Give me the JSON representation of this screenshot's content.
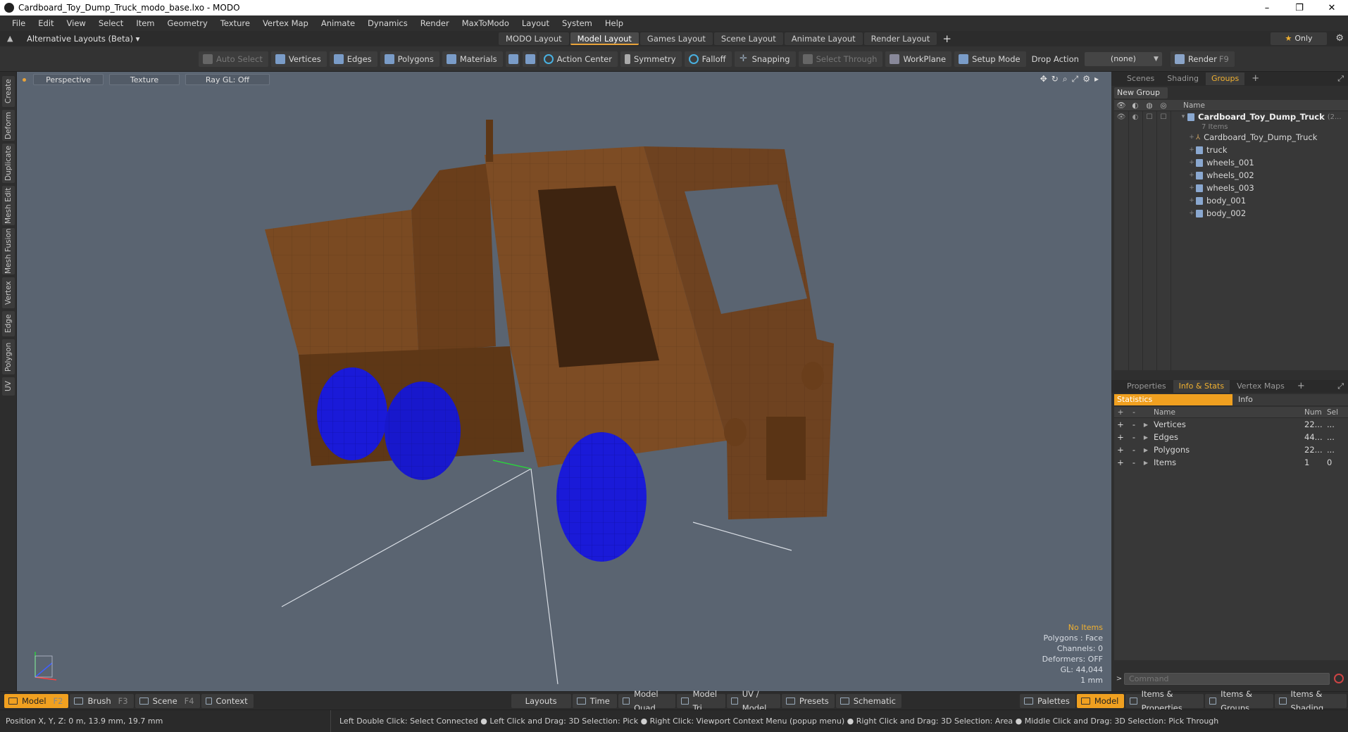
{
  "window": {
    "title": "Cardboard_Toy_Dump_Truck_modo_base.lxo - MODO",
    "minimize": "–",
    "maximize": "❐",
    "close": "✕"
  },
  "menu": [
    "File",
    "Edit",
    "View",
    "Select",
    "Item",
    "Geometry",
    "Texture",
    "Vertex Map",
    "Animate",
    "Dynamics",
    "Render",
    "MaxToModo",
    "Layout",
    "System",
    "Help"
  ],
  "layouts": {
    "alt_label": "Alternative Layouts (Beta) ▾",
    "tabs": [
      "MODO Layout",
      "Model Layout",
      "Games Layout",
      "Scene Layout",
      "Animate Layout",
      "Render Layout"
    ],
    "active_tab": "Model Layout",
    "plus": "+",
    "only": "Only",
    "star": "★",
    "gear": "⚙"
  },
  "toolbar": {
    "auto_select": "Auto Select",
    "vertices": "Vertices",
    "edges": "Edges",
    "polygons": "Polygons",
    "materials": "Materials",
    "action_center": "Action Center",
    "symmetry": "Symmetry",
    "falloff": "Falloff",
    "snapping": "Snapping",
    "select_through": "Select Through",
    "workplane": "WorkPlane",
    "setup_mode": "Setup Mode",
    "drop_action_label": "Drop Action",
    "drop_action_value": "(none)",
    "render": "Render",
    "render_key": "F9"
  },
  "left_tabs": [
    "Create",
    "Deform",
    "Duplicate",
    "Mesh Edit",
    "Mesh Fusion",
    "Vertex",
    "Edge",
    "Polygon",
    "UV"
  ],
  "viewport": {
    "view": "Perspective",
    "shading": "Texture",
    "raygl": "Ray GL: Off",
    "info": {
      "items": "No Items",
      "polygons": "Polygons : Face",
      "channels": "Channels: 0",
      "deformers": "Deformers: OFF",
      "gl": "GL: 44,044",
      "unit": "1 mm"
    },
    "colors": {
      "background": "#5a6471",
      "cardboard": "#7a4a22",
      "wheels": "#1a1ad8"
    }
  },
  "scene_panel": {
    "tabs": [
      "Scenes",
      "Shading",
      "Groups"
    ],
    "active_tab": "Groups",
    "new_group": "New Group",
    "name_header": "Name",
    "group": {
      "name": "Cardboard_Toy_Dump_Truck",
      "suffix": "(2...",
      "count": "7 Items"
    },
    "items": [
      "Cardboard_Toy_Dump_Truck",
      "truck",
      "wheels_001",
      "wheels_002",
      "wheels_003",
      "body_001",
      "body_002"
    ]
  },
  "info_panel": {
    "tabs": [
      "Properties",
      "Info & Stats",
      "Vertex Maps"
    ],
    "active_tab": "Info & Stats",
    "sub_tabs": {
      "statistics": "Statistics",
      "info": "Info"
    },
    "headers": {
      "name": "Name",
      "num": "Num",
      "sel": "Sel"
    },
    "rows": [
      {
        "name": "Vertices",
        "num": "22...",
        "sel": "..."
      },
      {
        "name": "Edges",
        "num": "44...",
        "sel": "..."
      },
      {
        "name": "Polygons",
        "num": "22...",
        "sel": "..."
      },
      {
        "name": "Items",
        "num": "1",
        "sel": "0"
      }
    ],
    "command_placeholder": "Command"
  },
  "bottombar": {
    "model": "Model",
    "model_key": "F2",
    "brush": "Brush",
    "brush_key": "F3",
    "scene": "Scene",
    "scene_key": "F4",
    "context": "Context",
    "layouts": "Layouts",
    "time": "Time",
    "model_quad": "Model Quad",
    "model_tri": "Model Tri",
    "uv_model": "UV / Model",
    "presets": "Presets",
    "schematic": "Schematic",
    "palettes": "Palettes",
    "model2": "Model",
    "items_props": "Items & Properties",
    "items_groups": "Items & Groups",
    "items_shading": "Items & Shading"
  },
  "status": {
    "position": "Position X, Y, Z:   0 m, 13.9 mm, 19.7 mm",
    "hint": "Left Double Click: Select Connected ● Left Click and Drag: 3D Selection: Pick ● Right Click: Viewport Context Menu (popup menu) ● Right Click and Drag: 3D Selection: Area ● Middle Click and Drag: 3D Selection: Pick Through"
  }
}
